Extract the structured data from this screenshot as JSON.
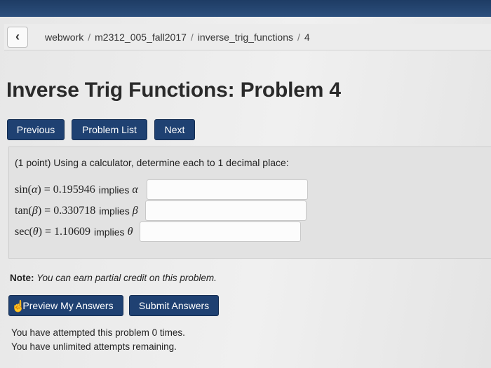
{
  "breadcrumb": {
    "back_icon": "chevron-left-icon",
    "items": [
      "webwork",
      "m2312_005_fall2017",
      "inverse_trig_functions",
      "4"
    ],
    "separator": "/"
  },
  "page_title": "Inverse Trig Functions: Problem 4",
  "nav": {
    "previous": "Previous",
    "problem_list": "Problem List",
    "next": "Next"
  },
  "problem": {
    "intro": "(1 point) Using a calculator, determine each to 1 decimal place:",
    "rows": [
      {
        "func": "sin",
        "var": "α",
        "value": "0.195946",
        "implies": "implies",
        "answer": ""
      },
      {
        "func": "tan",
        "var": "β",
        "value": "0.330718",
        "implies": "implies",
        "answer": ""
      },
      {
        "func": "sec",
        "var": "θ",
        "value": "1.10609",
        "implies": "implies",
        "answer": ""
      }
    ]
  },
  "note": {
    "label": "Note:",
    "text": "You can earn partial credit on this problem."
  },
  "actions": {
    "preview": "Preview My Answers",
    "submit": "Submit Answers"
  },
  "attempts": {
    "line1": "You have attempted this problem 0 times.",
    "line2": "You have unlimited attempts remaining."
  },
  "colors": {
    "header": "#1e3c64",
    "button": "#1f4172"
  }
}
